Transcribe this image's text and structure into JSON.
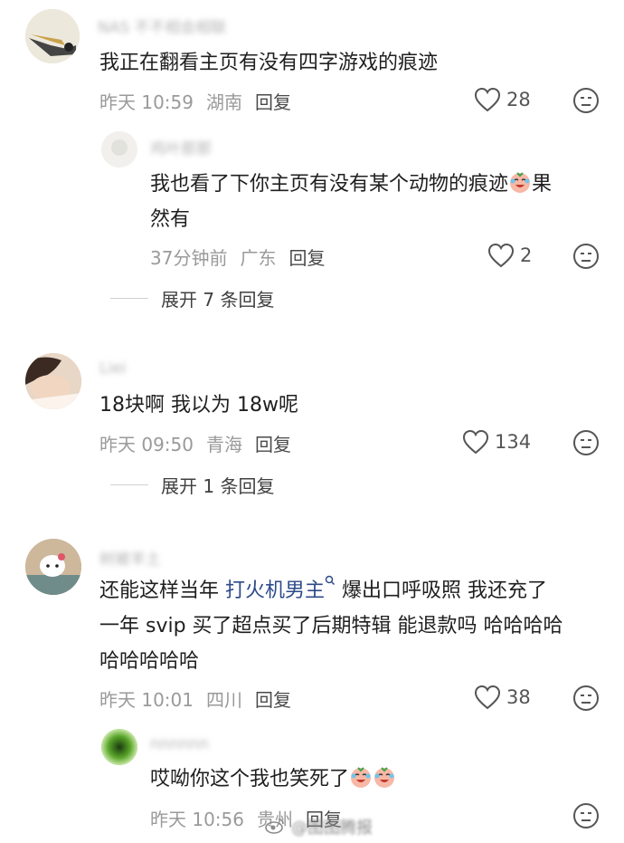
{
  "colors": {
    "text": "#1f1f1f",
    "meta": "#9a9a9a",
    "link": "#2d4a8a",
    "username_blurred": "#b5b5b5"
  },
  "comments": [
    {
      "username": "NAS 不不相会相联",
      "text": "我正在翻看主页有没有四字游戏的痕迹",
      "time": "昨天 10:59",
      "location": "湖南",
      "reply_label": "回复",
      "likes": "28"
    },
    {
      "username": "鸡叶那那",
      "text_before": "我也看了下你主页有没有某个动物的痕迹",
      "text_after": "果",
      "text_line2": "然有",
      "time": "37分钟前",
      "location": "广东",
      "reply_label": "回复",
      "likes": "2",
      "expand_label": "展开 7 条回复"
    },
    {
      "username": "Liei",
      "text": "18块啊 我以为 18w呢",
      "time": "昨天 09:50",
      "location": "青海",
      "reply_label": "回复",
      "likes": "134",
      "expand_label": "展开 1 条回复"
    },
    {
      "username": "树被羊土",
      "text_part1": "还能这样当年 ",
      "link_text": "打火机男主",
      "text_part2": " 爆出口呼吸照 我还充了",
      "text_line2": "一年 svip 买了超点买了后期特辑 能退款吗 哈哈哈哈",
      "text_line3": "哈哈哈哈哈",
      "time": "昨天 10:01",
      "location": "四川",
      "reply_label": "回复",
      "likes": "38"
    },
    {
      "username": "nnnnnn",
      "text": "哎呦你这个我也笑死了",
      "time": "昨天 10:56",
      "location": "贵州",
      "reply_label": "回复"
    }
  ],
  "watermark": "@图图腾报",
  "icons": [
    "heart-icon",
    "dislike-face-icon",
    "search-superscript-icon",
    "crying-laughing-emoji",
    "weibo-logo-icon"
  ]
}
